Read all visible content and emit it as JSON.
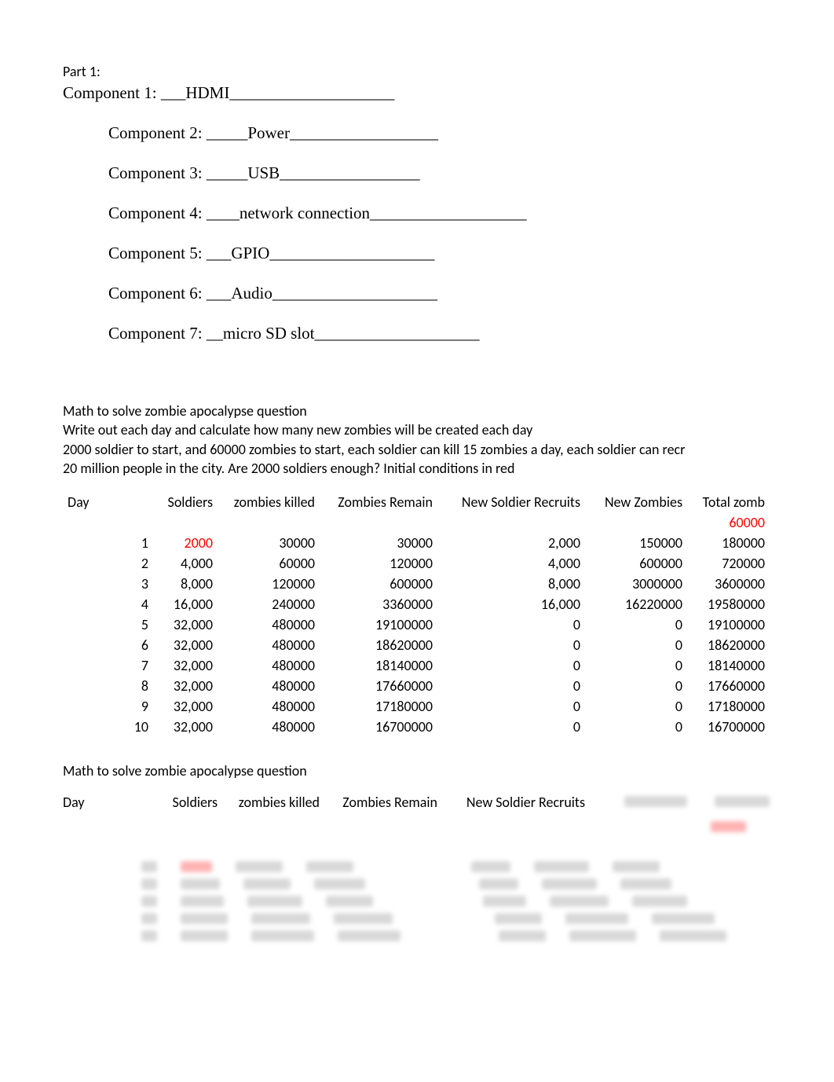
{
  "part1": {
    "label": "Part 1:",
    "components": [
      {
        "prefix": "Component 1: ___",
        "value": "HDMI",
        "suffix": "____________________",
        "indent": false
      },
      {
        "prefix": "Component 2: _____",
        "value": "Power",
        "suffix": "__________________",
        "indent": true
      },
      {
        "prefix": "Component 3: _____",
        "value": "USB",
        "suffix": "_________________",
        "indent": true
      },
      {
        "prefix": "Component 4: ____",
        "value": "network connection",
        "suffix": "___________________",
        "indent": true
      },
      {
        "prefix": "Component 5: ___",
        "value": "GPIO",
        "suffix": "____________________",
        "indent": true
      },
      {
        "prefix": "Component 6: ___",
        "value": "Audio",
        "suffix": "____________________",
        "indent": true
      },
      {
        "prefix": "Component 7: __",
        "value": "micro SD slot",
        "suffix": "____________________",
        "indent": true
      }
    ]
  },
  "math_section": {
    "title": "Math to solve zombie apocalypse question",
    "line1": "Write out each day and calculate how many new zombies will be created each day",
    "line2": "2000 soldier to start, and 60000 zombies to start, each soldier can kill 15 zombies a day, each soldier can recr",
    "line3": "20 million people in the city. Are 2000 soldiers enough? Initial conditions in red"
  },
  "table1": {
    "headers": [
      "Day",
      "Soldiers",
      "zombies killed",
      "Zombies Remain",
      "New Soldier Recruits",
      "New Zombies",
      "Total zomb"
    ],
    "initial_total": "60000",
    "rows": [
      {
        "day": "1",
        "soldiers": "2000",
        "killed": "30000",
        "remain": "30000",
        "recruits": "2,000",
        "newz": "150000",
        "total": "180000",
        "red_soldiers": true
      },
      {
        "day": "2",
        "soldiers": "4,000",
        "killed": "60000",
        "remain": "120000",
        "recruits": "4,000",
        "newz": "600000",
        "total": "720000"
      },
      {
        "day": "3",
        "soldiers": "8,000",
        "killed": "120000",
        "remain": "600000",
        "recruits": "8,000",
        "newz": "3000000",
        "total": "3600000"
      },
      {
        "day": "4",
        "soldiers": "16,000",
        "killed": "240000",
        "remain": "3360000",
        "recruits": "16,000",
        "newz": "16220000",
        "total": "19580000"
      },
      {
        "day": "5",
        "soldiers": "32,000",
        "killed": "480000",
        "remain": "19100000",
        "recruits": "0",
        "newz": "0",
        "total": "19100000"
      },
      {
        "day": "6",
        "soldiers": "32,000",
        "killed": "480000",
        "remain": "18620000",
        "recruits": "0",
        "newz": "0",
        "total": "18620000"
      },
      {
        "day": "7",
        "soldiers": "32,000",
        "killed": "480000",
        "remain": "18140000",
        "recruits": "0",
        "newz": "0",
        "total": "18140000"
      },
      {
        "day": "8",
        "soldiers": "32,000",
        "killed": "480000",
        "remain": "17660000",
        "recruits": "0",
        "newz": "0",
        "total": "17660000"
      },
      {
        "day": "9",
        "soldiers": "32,000",
        "killed": "480000",
        "remain": "17180000",
        "recruits": "0",
        "newz": "0",
        "total": "17180000"
      },
      {
        "day": "10",
        "soldiers": "32,000",
        "killed": "480000",
        "remain": "16700000",
        "recruits": "0",
        "newz": "0",
        "total": "16700000"
      }
    ]
  },
  "subtitle2": "Math to solve zombie apocalypse question",
  "table2_headers": [
    "Day",
    "Soldiers",
    "zombies killed",
    "Zombies Remain",
    "New Soldier Recruits"
  ],
  "chart_data": {
    "type": "table",
    "title": "Zombie apocalypse day-by-day simulation",
    "columns": [
      "Day",
      "Soldiers",
      "zombies killed",
      "Zombies Remain",
      "New Soldier Recruits",
      "New Zombies",
      "Total zomb"
    ],
    "initial_conditions": {
      "soldiers": 2000,
      "zombies": 60000,
      "city_population": 20000000,
      "kills_per_soldier": 15
    },
    "rows": [
      [
        1,
        2000,
        30000,
        30000,
        2000,
        150000,
        180000
      ],
      [
        2,
        4000,
        60000,
        120000,
        4000,
        600000,
        720000
      ],
      [
        3,
        8000,
        120000,
        600000,
        8000,
        3000000,
        3600000
      ],
      [
        4,
        16000,
        240000,
        3360000,
        16000,
        16220000,
        19580000
      ],
      [
        5,
        32000,
        480000,
        19100000,
        0,
        0,
        19100000
      ],
      [
        6,
        32000,
        480000,
        18620000,
        0,
        0,
        18620000
      ],
      [
        7,
        32000,
        480000,
        18140000,
        0,
        0,
        18140000
      ],
      [
        8,
        32000,
        480000,
        17660000,
        0,
        0,
        17660000
      ],
      [
        9,
        32000,
        480000,
        17180000,
        0,
        0,
        17180000
      ],
      [
        10,
        32000,
        480000,
        16700000,
        0,
        0,
        16700000
      ]
    ]
  }
}
